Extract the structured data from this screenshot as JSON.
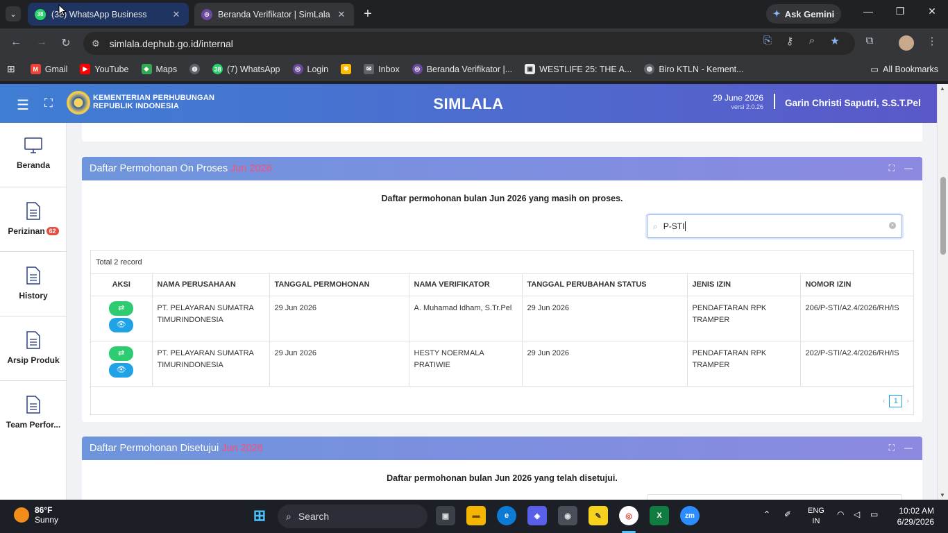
{
  "browser": {
    "tabs": [
      {
        "title": "(38) WhatsApp Business",
        "badge": "38",
        "active": false
      },
      {
        "title": "Beranda Verifikator | SimLala",
        "active": true
      }
    ],
    "ask_gemini": "Ask Gemini",
    "url": "simlala.dephub.go.id/internal",
    "bookmarks": [
      {
        "label": "Gmail",
        "icon": "gmail-icon"
      },
      {
        "label": "YouTube",
        "icon": "youtube-icon"
      },
      {
        "label": "Maps",
        "icon": "maps-icon"
      },
      {
        "label": "",
        "icon": "globe-icon"
      },
      {
        "label": "(7) WhatsApp",
        "icon": "whatsapp-icon"
      },
      {
        "label": "Login",
        "icon": "login-icon"
      },
      {
        "label": "",
        "icon": "pinwheel-icon"
      },
      {
        "label": "Inbox",
        "icon": "inbox-icon"
      },
      {
        "label": "Beranda Verifikator |...",
        "icon": "simlala-icon"
      },
      {
        "label": "WESTLIFE 25: THE A...",
        "icon": "bookmark-page-icon"
      },
      {
        "label": "Biro KTLN - Kement...",
        "icon": "globe-icon"
      }
    ],
    "all_bookmarks": "All Bookmarks"
  },
  "app": {
    "org_line1": "KEMENTERIAN PERHUBUNGAN",
    "org_line2": "REPUBLIK INDONESIA",
    "title": "SIMLALA",
    "date": "29 June 2026",
    "version": "versi 2.0.26",
    "user": "Garin Christi Saputri, S.S.T.Pel"
  },
  "sidebar": {
    "items": [
      {
        "label": "Beranda",
        "icon": "monitor-icon"
      },
      {
        "label": "Perizinan",
        "icon": "document-icon",
        "badge": "62"
      },
      {
        "label": "History",
        "icon": "document-icon"
      },
      {
        "label": "Arsip Produk",
        "icon": "document-icon"
      },
      {
        "label": "Team Perfor...",
        "icon": "document-icon"
      }
    ]
  },
  "panel_onproses": {
    "title": "Daftar Permohonan On Proses",
    "month": "Jun 2026",
    "description": "Daftar permohonan bulan Jun 2026 yang masih on proses.",
    "search_value": "P-STI",
    "total": "Total 2 record",
    "columns": [
      "AKSI",
      "NAMA PERUSAHAAN",
      "TANGGAL PERMOHONAN",
      "NAMA VERIFIKATOR",
      "TANGGAL PERUBAHAN STATUS",
      "JENIS IZIN",
      "NOMOR IZIN"
    ],
    "rows": [
      {
        "perusahaan": "PT. PELAYARAN SUMATRA TIMURINDONESIA",
        "tgl_permohonan": "29 Jun 2026",
        "verifikator": "A. Muhamad Idham, S.Tr.Pel",
        "tgl_status": "29 Jun 2026",
        "jenis": "PENDAFTARAN RPK TRAMPER",
        "nomor": "206/P-STI/A2.4/2026/RH/IS"
      },
      {
        "perusahaan": "PT. PELAYARAN SUMATRA TIMURINDONESIA",
        "tgl_permohonan": "29 Jun 2026",
        "verifikator": "HESTY NOERMALA PRATIWIE",
        "tgl_status": "29 Jun 2026",
        "jenis": "PENDAFTARAN RPK TRAMPER",
        "nomor": "202/P-STI/A2.4/2026/RH/IS"
      }
    ],
    "page": "1"
  },
  "panel_disetujui": {
    "title": "Daftar Permohonan Disetujui",
    "month": "Jun 2026",
    "description": "Daftar permohonan bulan Jun 2026 yang telah disetujui."
  },
  "taskbar": {
    "temp": "86°F",
    "weather": "Sunny",
    "search_placeholder": "Search",
    "lang1": "ENG",
    "lang2": "IN",
    "time": "10:02 AM",
    "date": "6/29/2026"
  }
}
